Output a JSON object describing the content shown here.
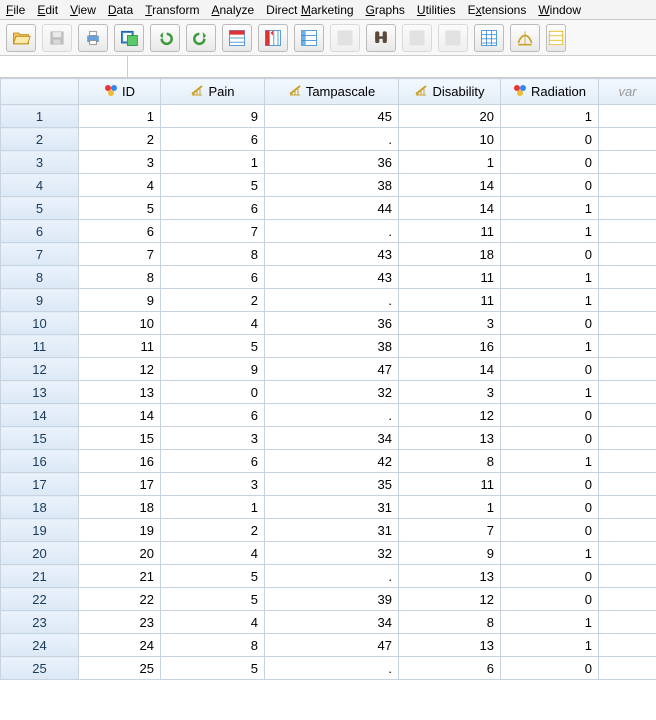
{
  "menu": {
    "items": [
      {
        "label": "File",
        "accel": "F"
      },
      {
        "label": "Edit",
        "accel": "E"
      },
      {
        "label": "View",
        "accel": "V"
      },
      {
        "label": "Data",
        "accel": "D"
      },
      {
        "label": "Transform",
        "accel": "T"
      },
      {
        "label": "Analyze",
        "accel": "A"
      },
      {
        "label": "Direct Marketing",
        "accel": "M"
      },
      {
        "label": "Graphs",
        "accel": "G"
      },
      {
        "label": "Utilities",
        "accel": "U"
      },
      {
        "label": "Extensions",
        "accel": "x"
      },
      {
        "label": "Window",
        "accel": "W"
      }
    ]
  },
  "toolbar": {
    "buttons": [
      "open-file",
      "save-file",
      "print",
      "recall-dialog",
      "undo",
      "redo",
      "goto-case",
      "goto-variable",
      "variables",
      "run-pending",
      "find",
      "split-file",
      "weight-cases",
      "value-labels",
      "use-sets",
      "show-all"
    ]
  },
  "columns": [
    {
      "name": "ID",
      "type": "nominal"
    },
    {
      "name": "Pain",
      "type": "scale"
    },
    {
      "name": "Tampascale",
      "type": "scale"
    },
    {
      "name": "Disability",
      "type": "scale"
    },
    {
      "name": "Radiation",
      "type": "nominal"
    }
  ],
  "extra_col_label": "var",
  "missing_marker": ".",
  "rows": [
    {
      "n": 1,
      "ID": 1,
      "Pain": 9,
      "Tampascale": 45,
      "Disability": 20,
      "Radiation": 1
    },
    {
      "n": 2,
      "ID": 2,
      "Pain": 6,
      "Tampascale": null,
      "Disability": 10,
      "Radiation": 0
    },
    {
      "n": 3,
      "ID": 3,
      "Pain": 1,
      "Tampascale": 36,
      "Disability": 1,
      "Radiation": 0
    },
    {
      "n": 4,
      "ID": 4,
      "Pain": 5,
      "Tampascale": 38,
      "Disability": 14,
      "Radiation": 0
    },
    {
      "n": 5,
      "ID": 5,
      "Pain": 6,
      "Tampascale": 44,
      "Disability": 14,
      "Radiation": 1
    },
    {
      "n": 6,
      "ID": 6,
      "Pain": 7,
      "Tampascale": null,
      "Disability": 11,
      "Radiation": 1
    },
    {
      "n": 7,
      "ID": 7,
      "Pain": 8,
      "Tampascale": 43,
      "Disability": 18,
      "Radiation": 0
    },
    {
      "n": 8,
      "ID": 8,
      "Pain": 6,
      "Tampascale": 43,
      "Disability": 11,
      "Radiation": 1
    },
    {
      "n": 9,
      "ID": 9,
      "Pain": 2,
      "Tampascale": null,
      "Disability": 11,
      "Radiation": 1
    },
    {
      "n": 10,
      "ID": 10,
      "Pain": 4,
      "Tampascale": 36,
      "Disability": 3,
      "Radiation": 0
    },
    {
      "n": 11,
      "ID": 11,
      "Pain": 5,
      "Tampascale": 38,
      "Disability": 16,
      "Radiation": 1
    },
    {
      "n": 12,
      "ID": 12,
      "Pain": 9,
      "Tampascale": 47,
      "Disability": 14,
      "Radiation": 0
    },
    {
      "n": 13,
      "ID": 13,
      "Pain": 0,
      "Tampascale": 32,
      "Disability": 3,
      "Radiation": 1
    },
    {
      "n": 14,
      "ID": 14,
      "Pain": 6,
      "Tampascale": null,
      "Disability": 12,
      "Radiation": 0
    },
    {
      "n": 15,
      "ID": 15,
      "Pain": 3,
      "Tampascale": 34,
      "Disability": 13,
      "Radiation": 0
    },
    {
      "n": 16,
      "ID": 16,
      "Pain": 6,
      "Tampascale": 42,
      "Disability": 8,
      "Radiation": 1
    },
    {
      "n": 17,
      "ID": 17,
      "Pain": 3,
      "Tampascale": 35,
      "Disability": 11,
      "Radiation": 0
    },
    {
      "n": 18,
      "ID": 18,
      "Pain": 1,
      "Tampascale": 31,
      "Disability": 1,
      "Radiation": 0
    },
    {
      "n": 19,
      "ID": 19,
      "Pain": 2,
      "Tampascale": 31,
      "Disability": 7,
      "Radiation": 0
    },
    {
      "n": 20,
      "ID": 20,
      "Pain": 4,
      "Tampascale": 32,
      "Disability": 9,
      "Radiation": 1
    },
    {
      "n": 21,
      "ID": 21,
      "Pain": 5,
      "Tampascale": null,
      "Disability": 13,
      "Radiation": 0
    },
    {
      "n": 22,
      "ID": 22,
      "Pain": 5,
      "Tampascale": 39,
      "Disability": 12,
      "Radiation": 0
    },
    {
      "n": 23,
      "ID": 23,
      "Pain": 4,
      "Tampascale": 34,
      "Disability": 8,
      "Radiation": 1
    },
    {
      "n": 24,
      "ID": 24,
      "Pain": 8,
      "Tampascale": 47,
      "Disability": 13,
      "Radiation": 1
    },
    {
      "n": 25,
      "ID": 25,
      "Pain": 5,
      "Tampascale": null,
      "Disability": 6,
      "Radiation": 0
    }
  ]
}
